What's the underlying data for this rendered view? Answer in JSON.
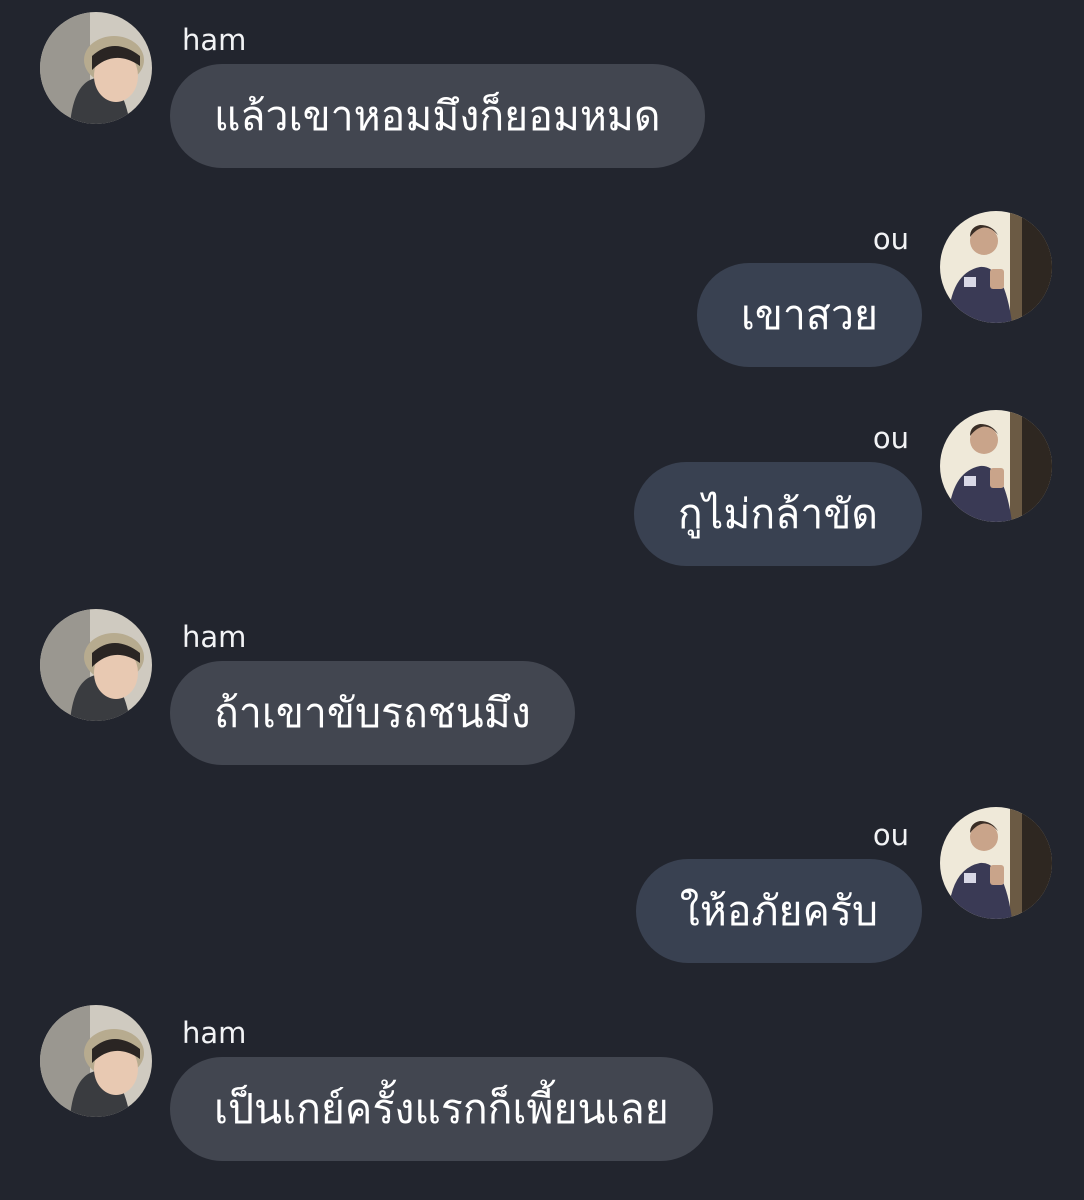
{
  "colors": {
    "background": "#22252e",
    "incoming_bubble": "#424650",
    "outgoing_bubble": "#394151",
    "text": "#ffffff"
  },
  "messages": [
    {
      "sender": "ham",
      "direction": "incoming",
      "text": "แล้วเขาหอมมึงก็ยอมหมด",
      "avatar_icon": "person-avatar-icon"
    },
    {
      "sender": "ou",
      "direction": "outgoing",
      "text": "เขาสวย",
      "avatar_icon": "person-avatar-icon"
    },
    {
      "sender": "ou",
      "direction": "outgoing",
      "text": "กูไม่กล้าขัด",
      "avatar_icon": "person-avatar-icon"
    },
    {
      "sender": "ham",
      "direction": "incoming",
      "text": "ถ้าเขาขับรถชนมึง",
      "avatar_icon": "person-avatar-icon"
    },
    {
      "sender": "ou",
      "direction": "outgoing",
      "text": "ให้อภัยครับ",
      "avatar_icon": "person-avatar-icon"
    },
    {
      "sender": "ham",
      "direction": "incoming",
      "text": "เป็นเกย์ครั้งแรกก็เพี้ยนเลย",
      "avatar_icon": "person-avatar-icon"
    }
  ]
}
